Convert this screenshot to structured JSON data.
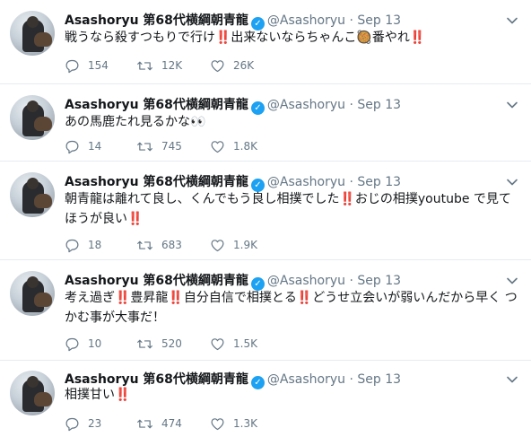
{
  "tweets": [
    {
      "name": "Asashoryu 第68代横綱朝青龍",
      "handle": "@Asashoryu",
      "dot": "·",
      "date": "Sep 13",
      "text": "戦うなら殺すつもりで行け‼️出来ないならちゃんこ🥘番やれ‼️",
      "replies": "154",
      "retweets": "12K",
      "likes": "26K"
    },
    {
      "name": "Asashoryu 第68代横綱朝青龍",
      "handle": "@Asashoryu",
      "dot": "·",
      "date": "Sep 13",
      "text": "あの馬鹿たれ見るかな👀",
      "replies": "14",
      "retweets": "745",
      "likes": "1.8K"
    },
    {
      "name": "Asashoryu 第68代横綱朝青龍",
      "handle": "@Asashoryu",
      "dot": "·",
      "date": "Sep 13",
      "text": "朝青龍は離れて良し、くんでもう良し相撲でした‼️おじの相撲youtube で見て ほうが良い‼️",
      "replies": "18",
      "retweets": "683",
      "likes": "1.9K"
    },
    {
      "name": "Asashoryu 第68代横綱朝青龍",
      "handle": "@Asashoryu",
      "dot": "·",
      "date": "Sep 13",
      "text": "考え過ぎ‼️豊昇龍‼️自分自信で相撲とる‼️どうせ立会いが弱いんだから早く つかむ事が大事だ！",
      "replies": "10",
      "retweets": "520",
      "likes": "1.5K"
    },
    {
      "name": "Asashoryu 第68代横綱朝青龍",
      "handle": "@Asashoryu",
      "dot": "·",
      "date": "Sep 13",
      "text": "相撲甘い‼️",
      "replies": "23",
      "retweets": "474",
      "likes": "1.3K"
    }
  ],
  "icons": {
    "verified": "verified-badge-icon",
    "caret": "chevron-down-icon",
    "reply": "reply-icon",
    "retweet": "retweet-icon",
    "like": "heart-icon"
  },
  "colors": {
    "verified": "#1da1f2",
    "muted": "#657786",
    "divider": "#e6ecf0"
  }
}
